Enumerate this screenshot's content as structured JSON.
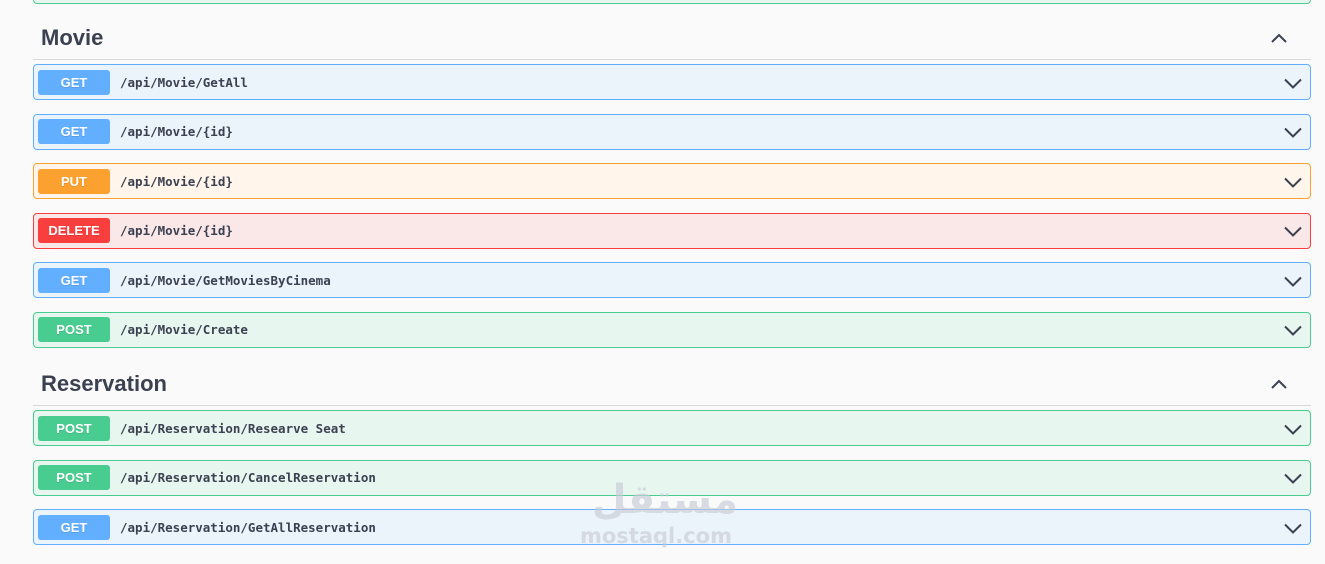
{
  "sections": [
    {
      "title": "Movie",
      "operations": [
        {
          "method": "GET",
          "path": "/api/Movie/GetAll"
        },
        {
          "method": "GET",
          "path": "/api/Movie/{id}"
        },
        {
          "method": "PUT",
          "path": "/api/Movie/{id}"
        },
        {
          "method": "DELETE",
          "path": "/api/Movie/{id}"
        },
        {
          "method": "GET",
          "path": "/api/Movie/GetMoviesByCinema"
        },
        {
          "method": "POST",
          "path": "/api/Movie/Create"
        }
      ]
    },
    {
      "title": "Reservation",
      "operations": [
        {
          "method": "POST",
          "path": "/api/Reservation/Researve Seat"
        },
        {
          "method": "POST",
          "path": "/api/Reservation/CancelReservation"
        },
        {
          "method": "GET",
          "path": "/api/Reservation/GetAllReservation"
        }
      ]
    }
  ],
  "watermark": {
    "logo": "مستقل",
    "url": "mostaql.com"
  },
  "icons": {
    "collapse": "chevron-up-icon",
    "expand": "chevron-down-icon"
  },
  "colors": {
    "get": "#61affe",
    "put": "#fca130",
    "delete": "#f93e3e",
    "post": "#49cc90",
    "title": "#3b4151"
  }
}
